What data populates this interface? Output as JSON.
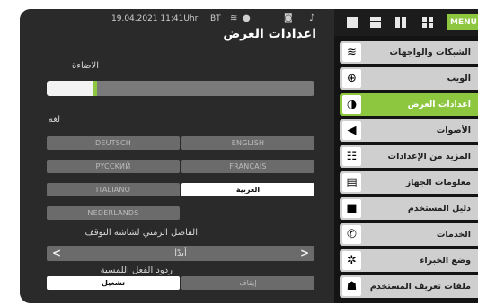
{
  "status": {
    "datetime": "19.04.2021 11:41Uhr",
    "bt": "BT",
    "icons": [
      "wifi-icon",
      "user-icon",
      "camera-icon",
      "microphone-icon"
    ]
  },
  "page": {
    "title": "اعدادات العرض",
    "brightness_label": "الاضاءة",
    "brightness_level": 0.17,
    "language_label": "لغة",
    "languages": [
      {
        "label": "DEUTSCH",
        "selected": false
      },
      {
        "label": "ENGLISH",
        "selected": false
      },
      {
        "label": "PYCCKИЙ",
        "selected": false
      },
      {
        "label": "FRANÇAIS",
        "selected": false
      },
      {
        "label": "ITALIANO",
        "selected": false
      },
      {
        "label": "العربية",
        "selected": true
      },
      {
        "label": "NEDERLANDS",
        "selected": false
      }
    ],
    "timeout_label": "الفاصل الزمني لشاشة التوقف",
    "timeout_value": "أبدًا",
    "haptic_label": "ردود الفعل اللمسية",
    "haptic_on": "تشغيل",
    "haptic_off": "إيقاف",
    "haptic_selected": "on"
  },
  "topbar": {
    "menu_label": "MENU",
    "layout_icons": [
      "single-view-icon",
      "split-horizontal-icon",
      "split-vertical-icon",
      "grid-view-icon"
    ]
  },
  "nav": [
    {
      "label": "الشبكات والواجهات",
      "icon": "wifi-icon",
      "active": false
    },
    {
      "label": "الويب",
      "icon": "globe-icon",
      "active": false
    },
    {
      "label": "اعدادات العرض",
      "icon": "contrast-icon",
      "active": true
    },
    {
      "label": "الأصوات",
      "icon": "speaker-icon",
      "active": false
    },
    {
      "label": "المزيد من الإعدادات",
      "icon": "sliders-icon",
      "active": false
    },
    {
      "label": "معلومات الجهاز",
      "icon": "device-info-icon",
      "active": false
    },
    {
      "label": "دليل المستخدم",
      "icon": "book-icon",
      "active": false
    },
    {
      "label": "الخدمات",
      "icon": "whatsapp-icon",
      "active": false
    },
    {
      "label": "وضع الخبراء",
      "icon": "gear-icon",
      "active": false
    },
    {
      "label": "ملفات تعريف المستخدم",
      "icon": "user-profile-icon",
      "active": false
    }
  ],
  "colors": {
    "accent": "#8dc63f",
    "panel": "#2a2a2a",
    "button": "#6b6b6b",
    "nav": "#cfcfcf"
  }
}
